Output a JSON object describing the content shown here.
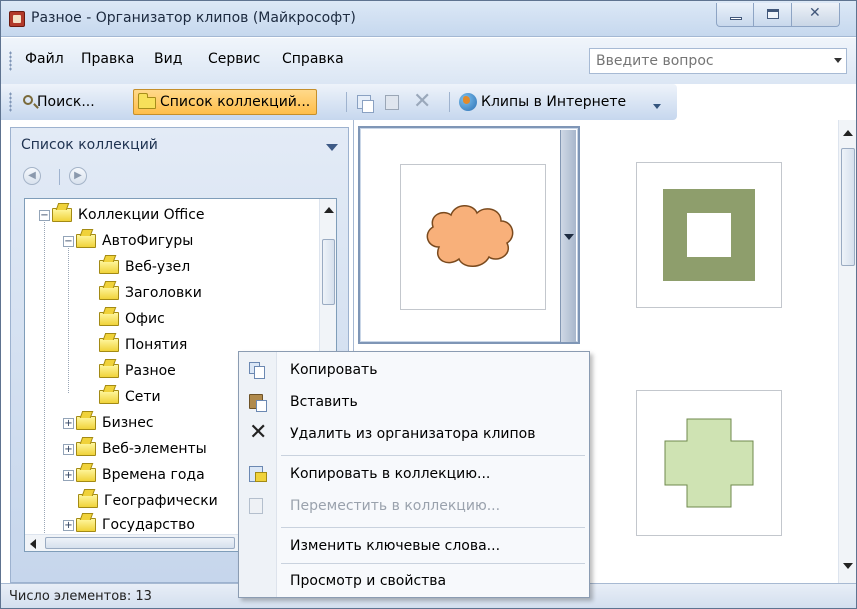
{
  "window": {
    "title": "Разное - Организатор клипов (Майкрософт)"
  },
  "menubar": {
    "items": [
      {
        "label": "Файл"
      },
      {
        "label": "Правка"
      },
      {
        "label": "Вид"
      },
      {
        "label": "Сервис"
      },
      {
        "label": "Справка"
      }
    ],
    "ask_placeholder": "Введите вопрос"
  },
  "toolbar": {
    "search_label": "Поиск...",
    "collection_list_label": "Список коллекций...",
    "online_clips_label": "Клипы в Интернете"
  },
  "taskpane": {
    "title": "Список коллекций"
  },
  "tree": {
    "items": [
      {
        "label": "Коллекции Office",
        "expander": "−"
      },
      {
        "label": "АвтоФигуры",
        "expander": "−"
      },
      {
        "label": "Веб-узел"
      },
      {
        "label": "Заголовки"
      },
      {
        "label": "Офис"
      },
      {
        "label": "Понятия"
      },
      {
        "label": "Разное"
      },
      {
        "label": "Сети"
      },
      {
        "label": "Бизнес",
        "expander": "+"
      },
      {
        "label": "Веб-элементы",
        "expander": "+"
      },
      {
        "label": "Времена года",
        "expander": "+"
      },
      {
        "label": "Географически"
      },
      {
        "label": "Государство",
        "expander": "+"
      }
    ]
  },
  "status": {
    "text": "Число элементов: 13"
  },
  "gallery": {
    "clips": [
      {
        "name": "cloud",
        "color": "#f8b07a"
      },
      {
        "name": "frame",
        "color": "#8e9e6c"
      },
      {
        "name": "cross",
        "color": "#cfe3b3"
      }
    ]
  },
  "context_menu": {
    "items": [
      {
        "label": "Копировать",
        "icon": "copy-icon"
      },
      {
        "label": "Вставить",
        "icon": "paste-icon"
      },
      {
        "label": "Удалить из организатора клипов",
        "icon": "delete-icon"
      },
      {
        "label": "Копировать в коллекцию...",
        "icon": "copy-to-collection-icon"
      },
      {
        "label": "Переместить в коллекцию...",
        "icon": "move-to-collection-icon",
        "disabled": true
      },
      {
        "label": "Изменить ключевые слова..."
      },
      {
        "label": "Просмотр и свойства"
      }
    ]
  },
  "colors": {
    "accent": "#ffbe4a",
    "titlebar": "#c6d8ee"
  }
}
